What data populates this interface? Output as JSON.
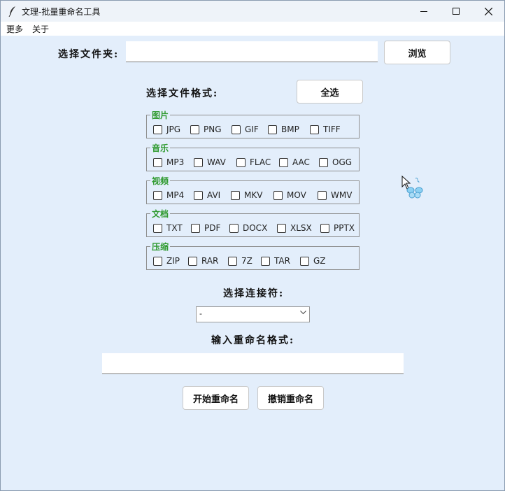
{
  "window": {
    "title": "文理-批量重命名工具",
    "controls": [
      "minimize-icon",
      "maximize-icon",
      "close-icon"
    ]
  },
  "menu": {
    "items": [
      "更多",
      "关于"
    ]
  },
  "folder": {
    "label": "选择文件夹:",
    "value": "",
    "browse": "浏览"
  },
  "formats": {
    "label": "选择文件格式:",
    "select_all": "全选",
    "groups": [
      {
        "title": "图片",
        "options": [
          "JPG",
          "PNG",
          "GIF",
          "BMP",
          "TIFF"
        ]
      },
      {
        "title": "音乐",
        "options": [
          "MP3",
          "WAV",
          "FLAC",
          "AAC",
          "OGG"
        ]
      },
      {
        "title": "视频",
        "options": [
          "MP4",
          "AVI",
          "MKV",
          "MOV",
          "WMV"
        ]
      },
      {
        "title": "文档",
        "options": [
          "TXT",
          "PDF",
          "DOCX",
          "XLSX",
          "PPTX"
        ]
      },
      {
        "title": "压缩",
        "options": [
          "ZIP",
          "RAR",
          "7Z",
          "TAR",
          "GZ"
        ]
      }
    ]
  },
  "connector": {
    "label": "选择连接符:",
    "selected": "-"
  },
  "rename_format": {
    "label": "输入重命名格式:",
    "value": ""
  },
  "actions": {
    "start": "开始重命名",
    "undo": "撤销重命名"
  },
  "colors": {
    "group_title": "#2f9a2f",
    "background": "#e3eefb"
  }
}
